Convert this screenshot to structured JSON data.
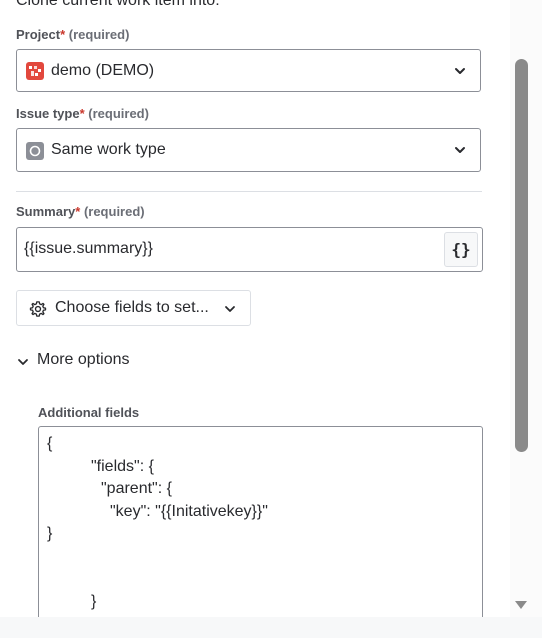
{
  "intro": "Clone current work item into:",
  "project": {
    "label": "Project",
    "required_mark": "*",
    "required_text": "(required)",
    "value": "demo (DEMO)",
    "icon": "project-avatar-icon"
  },
  "issue_type": {
    "label": "Issue type",
    "required_mark": "*",
    "required_text": "(required)",
    "value": "Same work type",
    "icon": "work-type-icon"
  },
  "summary": {
    "label": "Summary",
    "required_mark": "*",
    "required_text": "(required)",
    "value": "{{issue.summary}}",
    "smart_value_button": "{}"
  },
  "choose_fields": {
    "label": "Choose fields to set...",
    "icon": "gear-icon"
  },
  "more_options": {
    "label": "More options",
    "expanded": true
  },
  "additional_fields": {
    "label": "Additional fields",
    "lines": [
      "{",
      "\"fields\": {",
      "\"parent\": {",
      "\"key\": \"{{Initativekey}}\"",
      "}",
      "}"
    ]
  },
  "colors": {
    "required": "#c9372c",
    "project_icon": "#e2483d",
    "border": "#8c8f97"
  }
}
